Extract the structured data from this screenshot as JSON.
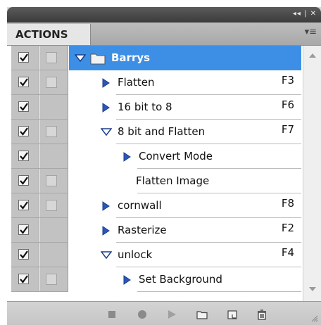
{
  "panel": {
    "tab": "ACTIONS",
    "title_buttons": "◂◂ | ✕"
  },
  "rows": [
    {
      "label": "Barrys",
      "key": "",
      "checked": true,
      "dialog": true,
      "expanded": true,
      "type": "set",
      "indent": 0,
      "selected": true
    },
    {
      "label": "Flatten",
      "key": "F3",
      "checked": true,
      "dialog": true,
      "expanded": false,
      "type": "action",
      "indent": 1
    },
    {
      "label": "16 bit to 8",
      "key": "F6",
      "checked": true,
      "dialog": false,
      "expanded": false,
      "type": "action",
      "indent": 1
    },
    {
      "label": "8 bit and Flatten",
      "key": "F7",
      "checked": true,
      "dialog": true,
      "expanded": true,
      "type": "action",
      "indent": 1
    },
    {
      "label": "Convert Mode",
      "key": "",
      "checked": true,
      "dialog": false,
      "expanded": false,
      "type": "command",
      "indent": 2
    },
    {
      "label": "Flatten Image",
      "key": "",
      "checked": true,
      "dialog": true,
      "expanded": false,
      "type": "command",
      "indent": 2
    },
    {
      "label": "cornwall",
      "key": "F8",
      "checked": true,
      "dialog": true,
      "expanded": false,
      "type": "action",
      "indent": 1
    },
    {
      "label": "Rasterize",
      "key": "F2",
      "checked": true,
      "dialog": false,
      "expanded": false,
      "type": "action",
      "indent": 1
    },
    {
      "label": "unlock",
      "key": "F4",
      "checked": true,
      "dialog": false,
      "expanded": true,
      "type": "action",
      "indent": 1
    },
    {
      "label": "Set Background",
      "key": "",
      "checked": true,
      "dialog": true,
      "expanded": false,
      "type": "command",
      "indent": 2
    }
  ],
  "footer_icons": [
    "stop-icon",
    "record-icon",
    "play-icon",
    "new-set-icon",
    "new-action-icon",
    "delete-icon"
  ],
  "colors": {
    "selected": "#3d8fe6",
    "titlebar": "#474747"
  }
}
